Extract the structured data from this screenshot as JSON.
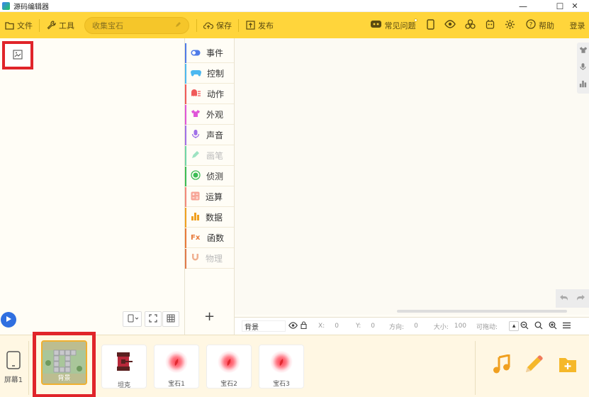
{
  "window": {
    "title": "源码编辑器",
    "controls": [
      "—",
      "☐",
      "✕"
    ]
  },
  "toolbar": {
    "file_label": "文件",
    "tools_label": "工具",
    "project_name": "收集宝石",
    "save_label": "保存",
    "publish_label": "发布",
    "faq_label": "常见问题",
    "help_label": "帮助",
    "login_label": "登录"
  },
  "categories": [
    {
      "label": "事件",
      "color": "#4f7be8",
      "enabled": true
    },
    {
      "label": "控制",
      "color": "#4cb8f0",
      "enabled": true
    },
    {
      "label": "动作",
      "color": "#f05a5a",
      "enabled": true
    },
    {
      "label": "外观",
      "color": "#e055d8",
      "enabled": true
    },
    {
      "label": "声音",
      "color": "#a070e8",
      "enabled": true
    },
    {
      "label": "画笔",
      "color": "#6fd6a6",
      "enabled": false
    },
    {
      "label": "侦测",
      "color": "#3cbd55",
      "enabled": true
    },
    {
      "label": "运算",
      "color": "#f28a7a",
      "enabled": true
    },
    {
      "label": "数据",
      "color": "#f0a020",
      "enabled": true
    },
    {
      "label": "函数",
      "color": "#e87a3a",
      "enabled": true
    },
    {
      "label": "物理",
      "color": "#e07a4a",
      "enabled": false
    }
  ],
  "categories_add": "+",
  "propbar": {
    "name": "背景",
    "x_label": "X:",
    "x_value": "0",
    "y_label": "Y:",
    "y_value": "0",
    "dir_label": "方向:",
    "dir_value": "0",
    "size_label": "大小:",
    "size_value": "100",
    "drag_label": "可拖动:"
  },
  "tray": {
    "screen_label": "屏幕1",
    "background_label": "背景",
    "sprites": [
      {
        "name": "坦克",
        "kind": "tank"
      },
      {
        "name": "宝石1",
        "kind": "gem"
      },
      {
        "name": "宝石2",
        "kind": "gem"
      },
      {
        "name": "宝石3",
        "kind": "gem"
      }
    ]
  },
  "colors": {
    "toolbar": "#ffd53b",
    "highlight": "#e0242a",
    "play": "#2f6fe0"
  }
}
